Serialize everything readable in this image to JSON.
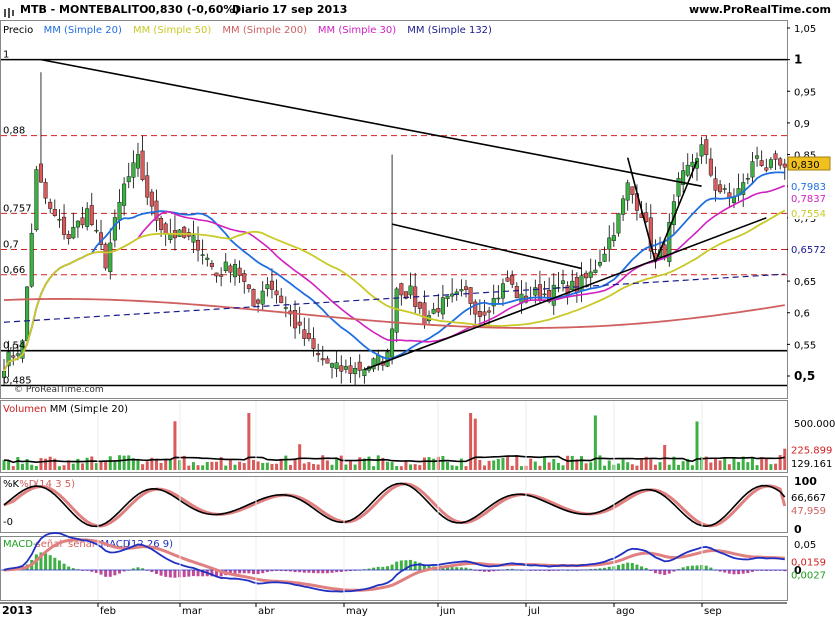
{
  "header": {
    "title": "MTB - MONTEBALITO",
    "quote": "0,830 (-0,60%)",
    "period": "Diario",
    "date": "17 sep 2013",
    "website": "www.ProRealTime.com"
  },
  "legends": {
    "price": [
      {
        "text": "Precio",
        "color": "#000000"
      },
      {
        "text": "MM (Simple 20)",
        "color": "#1f6fe0"
      },
      {
        "text": "MM (Simple 50)",
        "color": "#c9c928"
      },
      {
        "text": "MM (Simple 200)",
        "color": "#d06060"
      },
      {
        "text": "MM (Simple 30)",
        "color": "#d020c0"
      },
      {
        "text": "MM (Simple 132)",
        "color": "#1a1a8c"
      }
    ],
    "volume": [
      {
        "text": "Volumen",
        "color": "#d02020"
      },
      {
        "text": "MM (Simple 20)",
        "color": "#000000"
      }
    ],
    "stoch": [
      {
        "text": "%K",
        "color": "#000000"
      },
      {
        "text": "%D",
        "color": "#d06060"
      },
      {
        "text": "(14 3 5)",
        "color": "#d06060"
      }
    ],
    "macd": [
      {
        "text": "MACD-",
        "color": "#20a020"
      },
      {
        "text": "señal",
        "color": "#d06060"
      },
      {
        "text": "señal",
        "color": "#d06060"
      },
      {
        "text": "MACD",
        "color": "#2030c0"
      },
      {
        "text": "(12 26 9)",
        "color": "#2030c0"
      }
    ]
  },
  "watermark": "© ProRealTime.com",
  "x_axis": {
    "year": "2013",
    "months": [
      "feb",
      "mar",
      "abr",
      "may",
      "jun",
      "jul",
      "ago",
      "sep"
    ]
  },
  "price_axis": {
    "ticks": [
      "1,05",
      "1",
      "0,95",
      "0,9",
      "0,85",
      "0,8",
      "0,75",
      "0,7",
      "0,65",
      "0,6",
      "0,55",
      "0,5"
    ],
    "bold_ticks": [
      "1",
      "0,5"
    ],
    "level_labels": [
      "1",
      "0,88",
      "0,757",
      "0,7",
      "0,66",
      "0,54",
      "0,485"
    ],
    "value_labels": [
      {
        "text": "0,830",
        "bg": "#f0c020",
        "fg": "#000000"
      },
      {
        "text": "0,7983",
        "bg": "#ffffff",
        "fg": "#1f6fe0"
      },
      {
        "text": "0,7837",
        "bg": "#ffffff",
        "fg": "#d020c0"
      },
      {
        "text": "0,7554",
        "bg": "#ffffff",
        "fg": "#c9c928"
      },
      {
        "text": "0,6572",
        "bg": "#ffffff",
        "fg": "#1a1a8c"
      }
    ]
  },
  "volume_axis": {
    "tick": "500.000",
    "value_labels": [
      {
        "text": "225.899",
        "fg": "#d02020"
      },
      {
        "text": "129.161",
        "fg": "#000000"
      }
    ]
  },
  "stoch_axis": {
    "ticks": [
      "100",
      "0"
    ],
    "left_tick": "-0",
    "value_labels": [
      {
        "text": "66,667",
        "fg": "#000000"
      },
      {
        "text": "47,959",
        "fg": "#d06060"
      }
    ]
  },
  "macd_axis": {
    "ticks": [
      "0,05",
      "0"
    ],
    "value_labels": [
      {
        "text": "0,0159",
        "fg": "#d02020"
      },
      {
        "text": "0,0027",
        "fg": "#20a020"
      }
    ]
  },
  "chart_data": {
    "type": "candlestick",
    "symbol": "MTB",
    "y_range": [
      0.48,
      1.06
    ],
    "horizontal_levels": [
      {
        "value": 1.0,
        "style": "solid"
      },
      {
        "value": 0.88,
        "style": "dashed"
      },
      {
        "value": 0.757,
        "style": "dashed"
      },
      {
        "value": 0.7,
        "style": "dashed"
      },
      {
        "value": 0.66,
        "style": "dashed"
      },
      {
        "value": 0.54,
        "style": "solid"
      },
      {
        "value": 0.485,
        "style": "solid"
      }
    ],
    "last_values": {
      "close": 0.83,
      "change_pct": -0.6,
      "sma20": 0.7983,
      "sma30": 0.7837,
      "sma50": 0.7554,
      "sma132": 0.6572,
      "volume": 225899,
      "volume_sma20": 129161,
      "stoch_k": 66.667,
      "stoch_d": 47.959,
      "macd": 0.0159,
      "macd_hist": 0.0027
    },
    "close_keypoints": [
      [
        0,
        0.52
      ],
      [
        4,
        0.55
      ],
      [
        7,
        0.82
      ],
      [
        10,
        0.76
      ],
      [
        14,
        0.72
      ],
      [
        18,
        0.76
      ],
      [
        22,
        0.68
      ],
      [
        26,
        0.8
      ],
      [
        29,
        0.84
      ],
      [
        32,
        0.76
      ],
      [
        35,
        0.73
      ],
      [
        38,
        0.72
      ],
      [
        42,
        0.71
      ],
      [
        46,
        0.66
      ],
      [
        50,
        0.68
      ],
      [
        54,
        0.61
      ],
      [
        57,
        0.65
      ],
      [
        60,
        0.62
      ],
      [
        64,
        0.57
      ],
      [
        68,
        0.53
      ],
      [
        72,
        0.51
      ],
      [
        76,
        0.51
      ],
      [
        80,
        0.52
      ],
      [
        83,
        0.53
      ],
      [
        85,
        0.64
      ],
      [
        88,
        0.63
      ],
      [
        91,
        0.59
      ],
      [
        94,
        0.61
      ],
      [
        97,
        0.62
      ],
      [
        100,
        0.63
      ],
      [
        103,
        0.6
      ],
      [
        106,
        0.62
      ],
      [
        109,
        0.65
      ],
      [
        112,
        0.62
      ],
      [
        115,
        0.63
      ],
      [
        118,
        0.63
      ],
      [
        121,
        0.64
      ],
      [
        124,
        0.64
      ],
      [
        127,
        0.66
      ],
      [
        130,
        0.7
      ],
      [
        133,
        0.75
      ],
      [
        135,
        0.8
      ],
      [
        138,
        0.76
      ],
      [
        141,
        0.68
      ],
      [
        143,
        0.7
      ],
      [
        146,
        0.8
      ],
      [
        149,
        0.84
      ],
      [
        151,
        0.86
      ],
      [
        154,
        0.8
      ],
      [
        157,
        0.78
      ],
      [
        160,
        0.8
      ],
      [
        163,
        0.85
      ],
      [
        165,
        0.83
      ]
    ]
  }
}
